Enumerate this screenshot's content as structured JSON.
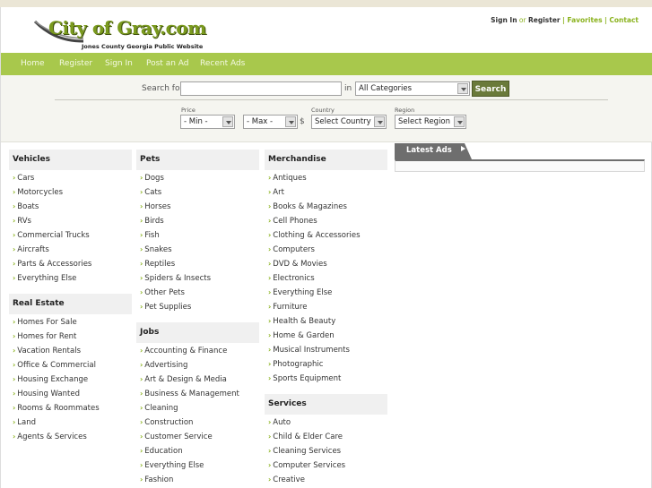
{
  "header": {
    "logo_text": "City of Gray.com",
    "tagline": "Jones County Georgia Public Website",
    "links": {
      "sign_in": "Sign In",
      "or": "or",
      "register": "Register",
      "favorites": "| Favorites",
      "contact": "| Contact"
    }
  },
  "nav": [
    "Home",
    "Register",
    "Sign In",
    "Post an Ad",
    "Recent Ads"
  ],
  "search": {
    "label": "Search for",
    "query": "",
    "in_label": "in",
    "category": "All Categories",
    "button": "Search",
    "price_label": "Price",
    "min": "- Min -",
    "max": "- Max -",
    "currency": "$",
    "country_label": "Country",
    "country": "Select Country",
    "region_label": "Region",
    "region": "Select Region"
  },
  "latest_ads": {
    "title": "Latest Ads"
  },
  "columns": [
    [
      {
        "title": "Vehicles",
        "items": [
          "Cars",
          "Motorcycles",
          "Boats",
          "RVs",
          "Commercial Trucks",
          "Aircrafts",
          "Parts & Accessories",
          "Everything Else"
        ]
      },
      {
        "title": "Real Estate",
        "items": [
          "Homes For Sale",
          "Homes for Rent",
          "Vacation Rentals",
          "Office & Commercial",
          "Housing Exchange",
          "Housing Wanted",
          "Rooms & Roommates",
          "Land",
          "Agents & Services"
        ]
      }
    ],
    [
      {
        "title": "Pets",
        "items": [
          "Dogs",
          "Cats",
          "Horses",
          "Birds",
          "Fish",
          "Snakes",
          "Reptiles",
          "Spiders & Insects",
          "Other Pets",
          "Pet Supplies"
        ]
      },
      {
        "title": "Jobs",
        "items": [
          "Accounting & Finance",
          "Advertising",
          "Art & Design & Media",
          "Business & Management",
          "Cleaning",
          "Construction",
          "Customer Service",
          "Education",
          "Everything Else",
          "Fashion"
        ]
      }
    ],
    [
      {
        "title": "Merchandise",
        "items": [
          "Antiques",
          "Art",
          "Books & Magazines",
          "Cell Phones",
          "Clothing & Accessories",
          "Computers",
          "DVD & Movies",
          "Electronics",
          "Everything Else",
          "Furniture",
          "Health & Beauty",
          "Home & Garden",
          "Musical Instruments",
          "Photographic",
          "Sports Equipment"
        ]
      },
      {
        "title": "Services",
        "items": [
          "Auto",
          "Child & Elder Care",
          "Cleaning Services",
          "Computer Services",
          "Creative"
        ]
      }
    ]
  ]
}
